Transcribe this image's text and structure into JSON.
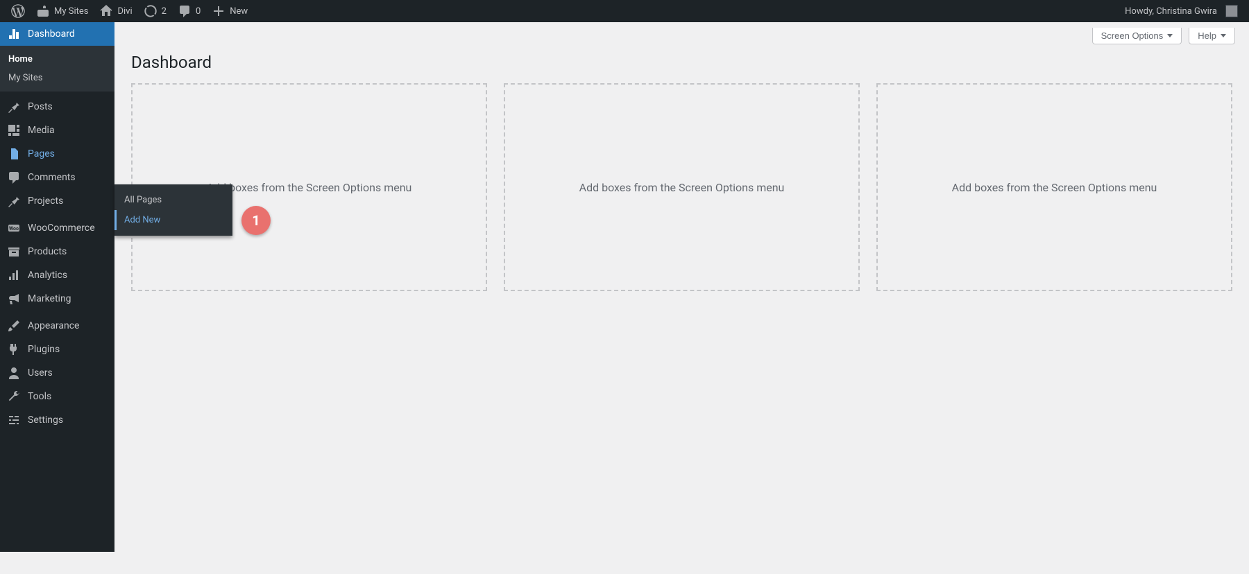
{
  "adminbar": {
    "my_sites_label": "My Sites",
    "site_name_label": "Divi",
    "updates_count": "2",
    "comments_count": "0",
    "new_label": "New",
    "greeting": "Howdy, Christina Gwira"
  },
  "sidebar": {
    "dashboard_label": "Dashboard",
    "submenu": {
      "home_label": "Home",
      "my_sites_label": "My Sites"
    },
    "items": [
      {
        "id": "posts",
        "label": "Posts"
      },
      {
        "id": "media",
        "label": "Media"
      },
      {
        "id": "pages",
        "label": "Pages"
      },
      {
        "id": "comments",
        "label": "Comments"
      },
      {
        "id": "projects",
        "label": "Projects"
      },
      {
        "id": "woocommerce",
        "label": "WooCommerce"
      },
      {
        "id": "products",
        "label": "Products"
      },
      {
        "id": "analytics",
        "label": "Analytics"
      },
      {
        "id": "marketing",
        "label": "Marketing"
      },
      {
        "id": "appearance",
        "label": "Appearance"
      },
      {
        "id": "plugins",
        "label": "Plugins"
      },
      {
        "id": "users",
        "label": "Users"
      },
      {
        "id": "tools",
        "label": "Tools"
      },
      {
        "id": "settings",
        "label": "Settings"
      }
    ]
  },
  "flyout": {
    "all_pages_label": "All Pages",
    "add_new_label": "Add New"
  },
  "annotation": {
    "badge_1": "1"
  },
  "header": {
    "page_title": "Dashboard",
    "screen_options_label": "Screen Options",
    "help_label": "Help"
  },
  "dashboard": {
    "placeholder_text": "Add boxes from the Screen Options menu"
  }
}
